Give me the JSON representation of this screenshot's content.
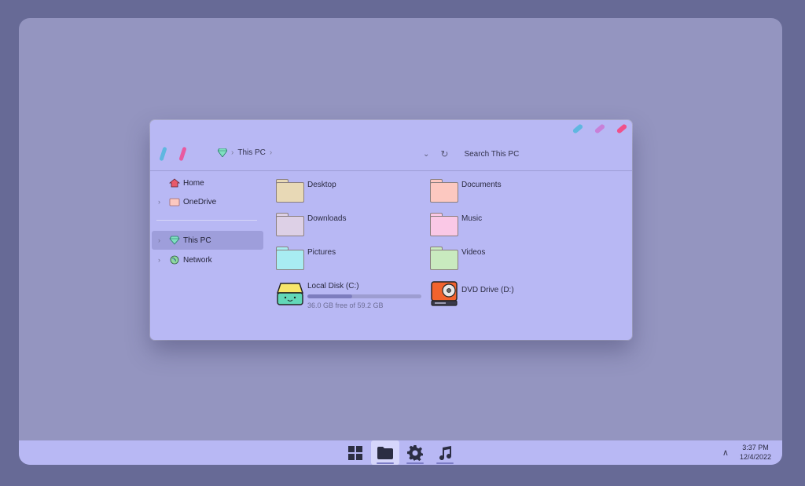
{
  "window": {
    "breadcrumb": [
      "This PC"
    ],
    "search_placeholder": "Search This PC",
    "caption_colors": [
      "#5fb7e0",
      "#c880d8",
      "#f0508a"
    ],
    "nav_colors": [
      "#5fb7e0",
      "#e85aa0"
    ]
  },
  "sidebar": {
    "items": [
      {
        "label": "Home",
        "icon": "home-icon",
        "expandable": false
      },
      {
        "label": "OneDrive",
        "icon": "onedrive-folder-icon",
        "expandable": true
      },
      {
        "label": "This PC",
        "icon": "this-pc-gem-icon",
        "expandable": true,
        "active": true
      },
      {
        "label": "Network",
        "icon": "network-globe-icon",
        "expandable": true
      }
    ]
  },
  "folders": [
    {
      "label": "Desktop",
      "color": "#e8d9b6"
    },
    {
      "label": "Documents",
      "color": "#fcc8c0"
    },
    {
      "label": "Downloads",
      "color": "#ddd0e6"
    },
    {
      "label": "Music",
      "color": "#fac8e6"
    },
    {
      "label": "Pictures",
      "color": "#a8ecf2"
    },
    {
      "label": "Videos",
      "color": "#c9eabf"
    }
  ],
  "drives": [
    {
      "label": "Local Disk (C:)",
      "free_text": "36.0 GB free of 59.2 GB",
      "used_fraction": 0.39
    },
    {
      "label": "DVD Drive (D:)"
    }
  ],
  "taskbar": {
    "apps": [
      "start-icon",
      "file-explorer-icon",
      "settings-gear-icon",
      "music-note-icon"
    ],
    "time": "3:37 PM",
    "date": "12/4/2022"
  }
}
